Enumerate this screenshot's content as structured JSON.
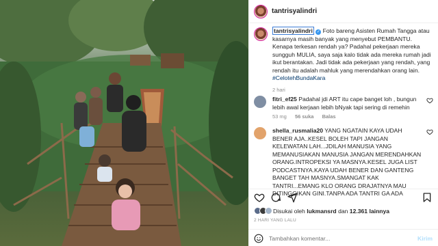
{
  "post": {
    "username": "tantrisyalindri",
    "caption": "Foto bareng Asisten Rumah Tangga atau kasarnya masih banyak yang menyebut PEMBANTU. Kenapa terkesan rendah ya? Padahal pekerjaan mereka sungguh MULIA, saya saja kalo tidak ada mereka rumah jadi ikut berantakan. Jadi tidak ada pekerjaan yang rendah, yang rendah itu adalah mahluk yang merendahkan orang lain.",
    "hashtag": "#CelotehBundaKara",
    "time": "2 hari"
  },
  "comments": [
    {
      "username": "fitri_ef25",
      "text": "Padahal jdi ART itu cape banget loh , bungun lebih awal kerjaan lebih bNyak tapi sering di remehin",
      "time": "53 mg",
      "likes": "56 suka",
      "reply": "Balas",
      "avatar_color": "#7f8ea3"
    },
    {
      "username": "shella_rusmalia20",
      "text": "YANG NGATAIN KAYA UDAH BENER AJA..KESEL BOLEH TAPI JANGAN KELEWATAN LAH...JDILAH MANUSIA YANG MEMANUSIAKAN MANUSIA JANGAN MERENDAHKAN ORANG.INTROPEKSI YA MASNYA.KESEL JUGA LIST PODCASTNYA.KAYA UDAH BENER DAN GANTENG BANGET TAH MASNYA.SMANGAT KAK TANTRI...EMANG KLO ORANG DRAJATNYA MAU DITINGGIKAN GINI.TANPA ADA TANTRI GA ADA",
      "avatar_color": "#e2a36b"
    }
  ],
  "likes": {
    "prefix": "Disukai oleh",
    "user": "lukmansrd",
    "joiner": "dan",
    "count": "12.361 lainnya"
  },
  "date": "2 HARI YANG LALU",
  "add_comment": {
    "placeholder": "Tambahkan komentar...",
    "post_label": "Kirim"
  },
  "icons": [
    "heart-icon",
    "comment-icon",
    "share-icon",
    "bookmark-icon",
    "smile-icon"
  ]
}
